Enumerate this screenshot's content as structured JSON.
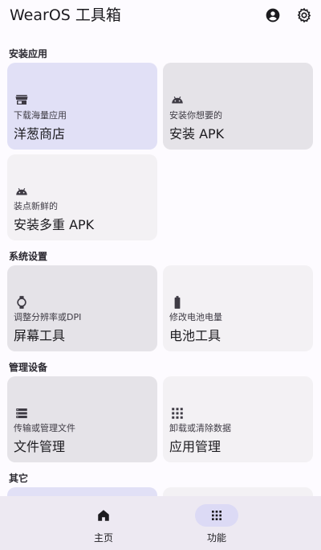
{
  "app_title": "WearOS 工具箱",
  "header_icons": [
    "account-icon",
    "settings-icon"
  ],
  "sections": {
    "install": {
      "title": "安装应用",
      "cards": [
        {
          "subtitle": "下载海量应用",
          "title": "洋葱商店",
          "icon": "store-icon"
        },
        {
          "subtitle": "安装你想要的",
          "title": "安装 APK",
          "icon": "android-icon"
        },
        {
          "subtitle": "装点新鲜的",
          "title": "安装多重 APK",
          "icon": "android-icon"
        }
      ]
    },
    "system": {
      "title": "系统设置",
      "cards": [
        {
          "subtitle": "调整分辨率或DPI",
          "title": "屏幕工具",
          "icon": "watch-icon"
        },
        {
          "subtitle": "修改电池电量",
          "title": "电池工具",
          "icon": "battery-icon"
        }
      ]
    },
    "manage": {
      "title": "管理设备",
      "cards": [
        {
          "subtitle": "传输或管理文件",
          "title": "文件管理",
          "icon": "list-icon"
        },
        {
          "subtitle": "卸载或清除数据",
          "title": "应用管理",
          "icon": "apps-icon"
        }
      ]
    },
    "other": {
      "title": "其它"
    }
  },
  "bottom_nav": [
    {
      "label": "主页",
      "icon": "home-icon",
      "selected": false
    },
    {
      "label": "功能",
      "icon": "apps-icon",
      "selected": true
    }
  ],
  "colors": {
    "background": "#fdfbff",
    "card_highlight": "#e1e0f6",
    "card_gray": "#e5e3e8",
    "card_light": "#f3f1f4",
    "nav_background": "#ede9f2",
    "nav_selected_pill": "#dcdaf5"
  }
}
